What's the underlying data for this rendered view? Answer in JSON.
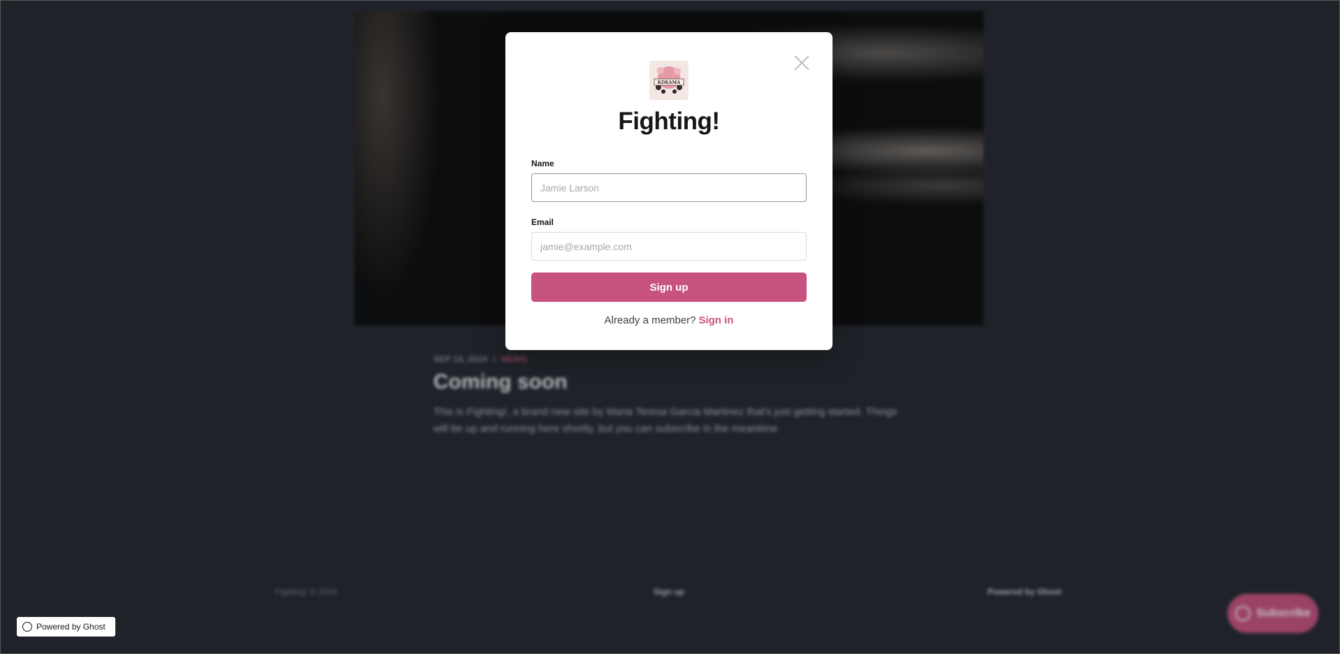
{
  "background_page": {
    "post_date": "SEP 14, 2024",
    "post_separator": "/",
    "post_category": "NEWS",
    "post_title": "Coming soon",
    "post_excerpt": "This is Fighting!, a brand new site by Maria Teresa Garcia Martinez that's just getting started. Things will be up and running here shortly, but you can subscribe in the meantime",
    "footer_left": "Fighting! © 2024",
    "footer_mid": "Sign up",
    "footer_right": "Powered by Ghost",
    "subscribe_button": "Subscribe"
  },
  "badge": {
    "label": "Powered by Ghost"
  },
  "modal": {
    "logo_text": "KDRAMA",
    "title": "Fighting!",
    "name_label": "Name",
    "name_placeholder": "Jamie Larson",
    "email_label": "Email",
    "email_placeholder": "jamie@example.com",
    "submit_label": "Sign up",
    "member_prompt": "Already a member?",
    "signin_label": "Sign in"
  },
  "colors": {
    "accent": "#c8527f",
    "page_background": "#23272e"
  }
}
